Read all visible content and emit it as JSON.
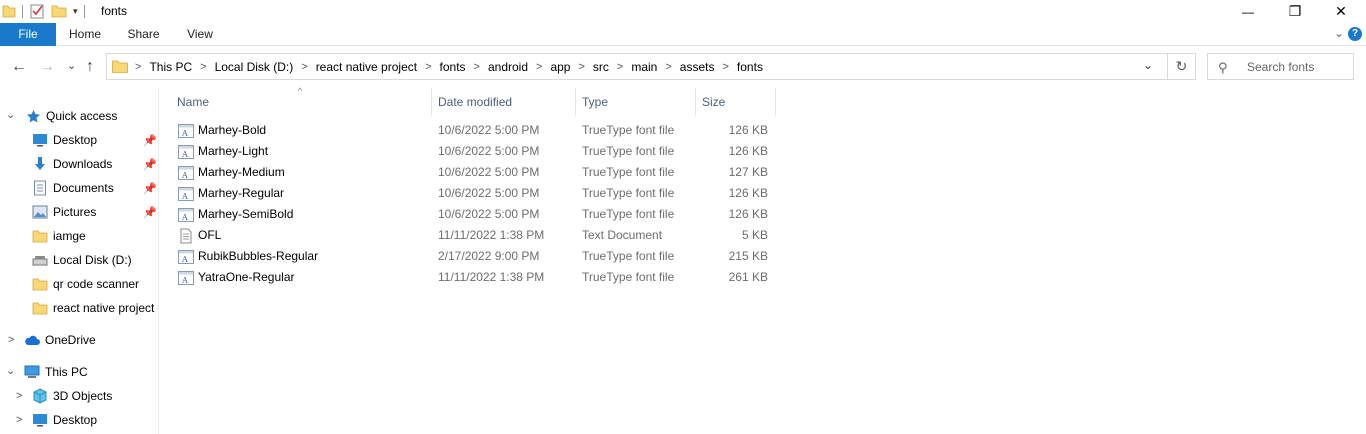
{
  "window": {
    "title": "fonts",
    "minimize_glyph": "—",
    "restore_glyph": "❐",
    "close_glyph": "✕"
  },
  "ribbon": {
    "tabs": [
      "File",
      "Home",
      "Share",
      "View"
    ],
    "expand_glyph": "⌄",
    "help_glyph": "?"
  },
  "address": {
    "back_glyph": "←",
    "forward_glyph": "→",
    "recent_glyph": "⌄",
    "up_glyph": "↑",
    "crumbs": [
      "This PC",
      "Local Disk (D:)",
      "react native project",
      "fonts",
      "android",
      "app",
      "src",
      "main",
      "assets",
      "fonts"
    ],
    "separator_glyph": ">",
    "dropdown_glyph": "⌄",
    "refresh_glyph": "↻"
  },
  "search": {
    "placeholder": "Search fonts",
    "icon_glyph": "⚲"
  },
  "columns": {
    "name": "Name",
    "date": "Date modified",
    "type": "Type",
    "size": "Size",
    "sort_glyph": "^"
  },
  "nav": {
    "expand_glyph": ">",
    "collapse_glyph": "⌄",
    "pin_glyph": "📌",
    "quick_access": "Quick access",
    "qa_items": [
      "Desktop",
      "Downloads",
      "Documents",
      "Pictures",
      "iamge",
      "Local Disk (D:)",
      "qr code scanner",
      "react native project"
    ],
    "onedrive": "OneDrive",
    "this_pc": "This PC",
    "pc_items": [
      "3D Objects",
      "Desktop"
    ]
  },
  "files": [
    {
      "name": "Marhey-Bold",
      "date": "10/6/2022 5:00 PM",
      "type": "TrueType font file",
      "size": "126 KB"
    },
    {
      "name": "Marhey-Light",
      "date": "10/6/2022 5:00 PM",
      "type": "TrueType font file",
      "size": "126 KB"
    },
    {
      "name": "Marhey-Medium",
      "date": "10/6/2022 5:00 PM",
      "type": "TrueType font file",
      "size": "127 KB"
    },
    {
      "name": "Marhey-Regular",
      "date": "10/6/2022 5:00 PM",
      "type": "TrueType font file",
      "size": "126 KB"
    },
    {
      "name": "Marhey-SemiBold",
      "date": "10/6/2022 5:00 PM",
      "type": "TrueType font file",
      "size": "126 KB"
    },
    {
      "name": "OFL",
      "date": "11/11/2022 1:38 PM",
      "type": "Text Document",
      "size": "5 KB"
    },
    {
      "name": "RubikBubbles-Regular",
      "date": "2/17/2022 9:00 PM",
      "type": "TrueType font file",
      "size": "215 KB"
    },
    {
      "name": "YatraOne-Regular",
      "date": "11/11/2022 1:38 PM",
      "type": "TrueType font file",
      "size": "261 KB"
    }
  ],
  "colors": {
    "accent": "#1979ca",
    "folder": "#f8d775",
    "header_text": "#4c607a",
    "secondary_text": "#6d6d6d"
  }
}
